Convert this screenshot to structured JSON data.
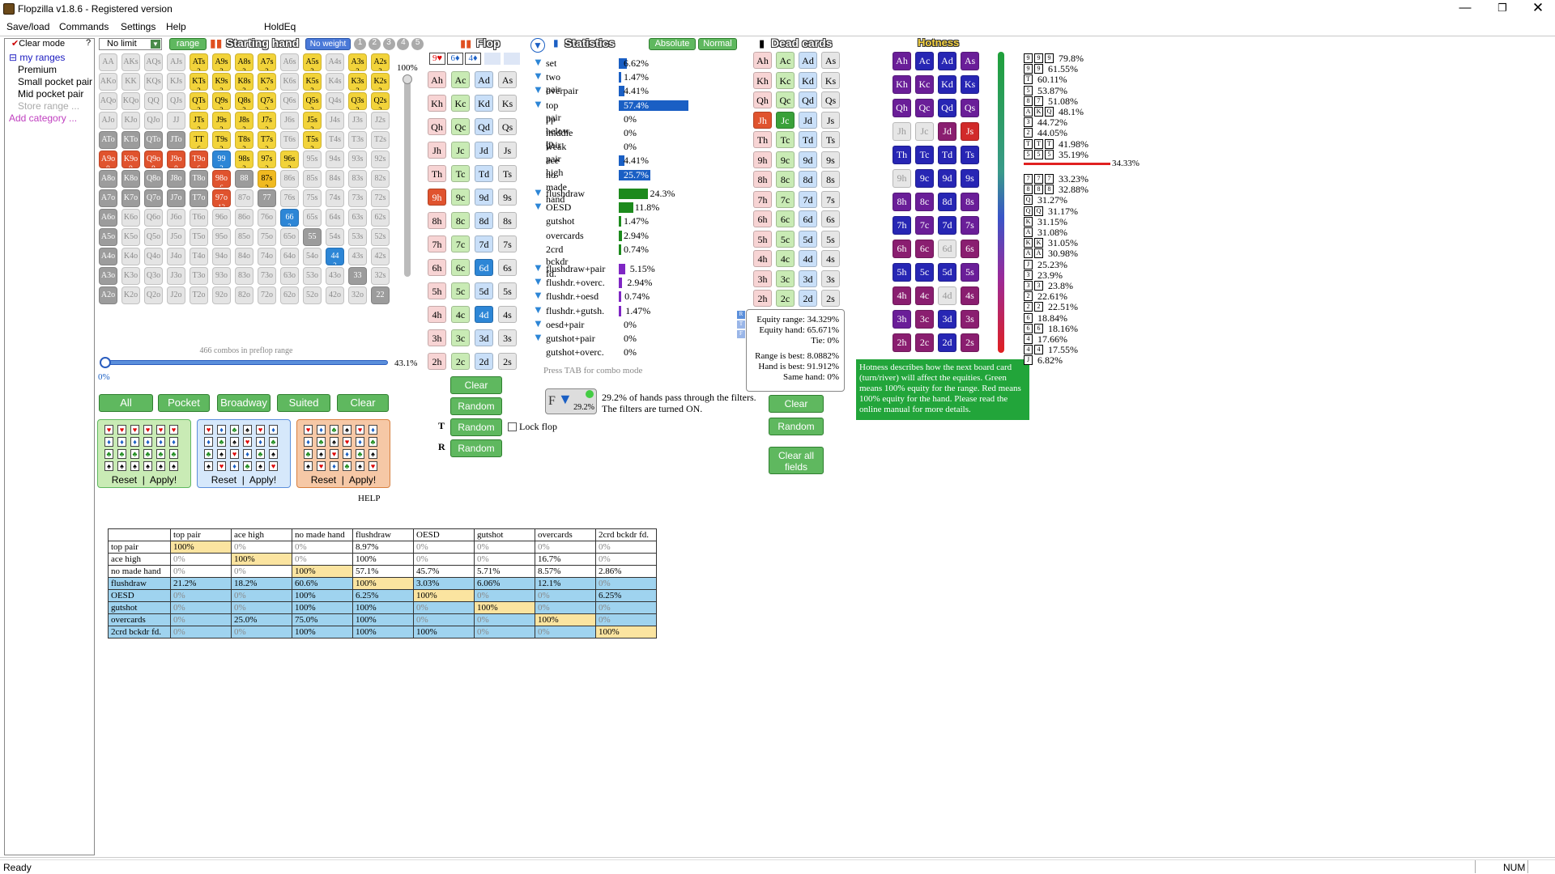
{
  "window": {
    "title": "Flopzilla v1.8.6 - Registered version"
  },
  "menu": [
    "Save/load",
    "Commands",
    "Settings",
    "Help",
    "HoldEq"
  ],
  "status": {
    "text": "Ready",
    "num": "NUM"
  },
  "left": {
    "clear_mode": "Clear mode",
    "help_q": "?",
    "root": "my ranges",
    "items": [
      "Premium",
      "Small pocket pair",
      "Mid pocket pair"
    ],
    "store": "Store range ...",
    "add": "Add category ..."
  },
  "range": {
    "limit": "No limit",
    "range_btn": "range",
    "header": "Starting hand",
    "noweight": "No weight",
    "weights": [
      "1",
      "2",
      "3",
      "4",
      "5"
    ],
    "pct_top": "100%",
    "combos": "466 combos in preflop range",
    "slider_pct": "43.1%",
    "slider_min": "0%",
    "buttons": [
      "All",
      "Pocket",
      "Broadway",
      "Suited",
      "Clear"
    ],
    "reset": "Reset",
    "apply": "Apply!",
    "help": "HELP"
  },
  "grid": [
    [
      "AA",
      "AKs",
      "AQs",
      "AJs",
      "ATs",
      "A9s",
      "A8s",
      "A7s",
      "A6s",
      "A5s",
      "A4s",
      "A3s",
      "A2s"
    ],
    [
      "AKo",
      "KK",
      "KQs",
      "KJs",
      "KTs",
      "K9s",
      "K8s",
      "K7s",
      "K6s",
      "K5s",
      "K4s",
      "K3s",
      "K2s"
    ],
    [
      "AQo",
      "KQo",
      "QQ",
      "QJs",
      "QTs",
      "Q9s",
      "Q8s",
      "Q7s",
      "Q6s",
      "Q5s",
      "Q4s",
      "Q3s",
      "Q2s"
    ],
    [
      "AJo",
      "KJo",
      "QJo",
      "JJ",
      "JTs",
      "J9s",
      "J8s",
      "J7s",
      "J6s",
      "J5s",
      "J4s",
      "J3s",
      "J2s"
    ],
    [
      "ATo",
      "KTo",
      "QTo",
      "JTo",
      "TT",
      "T9s",
      "T8s",
      "T7s",
      "T6s",
      "T5s",
      "T4s",
      "T3s",
      "T2s"
    ],
    [
      "A9o",
      "K9o",
      "Q9o",
      "J9o",
      "T9o",
      "99",
      "98s",
      "97s",
      "96s",
      "95s",
      "94s",
      "93s",
      "92s"
    ],
    [
      "A8o",
      "K8o",
      "Q8o",
      "J8o",
      "T8o",
      "98o",
      "88",
      "87s",
      "86s",
      "85s",
      "84s",
      "83s",
      "82s"
    ],
    [
      "A7o",
      "K7o",
      "Q7o",
      "J7o",
      "T7o",
      "97o",
      "87o",
      "77",
      "76s",
      "75s",
      "74s",
      "73s",
      "72s"
    ],
    [
      "A6o",
      "K6o",
      "Q6o",
      "J6o",
      "T6o",
      "96o",
      "86o",
      "76o",
      "66",
      "65s",
      "64s",
      "63s",
      "62s"
    ],
    [
      "A5o",
      "K5o",
      "Q5o",
      "J5o",
      "T5o",
      "95o",
      "85o",
      "75o",
      "65o",
      "55",
      "54s",
      "53s",
      "52s"
    ],
    [
      "A4o",
      "K4o",
      "Q4o",
      "J4o",
      "T4o",
      "94o",
      "84o",
      "74o",
      "64o",
      "54o",
      "44",
      "43s",
      "42s"
    ],
    [
      "A3o",
      "K3o",
      "Q3o",
      "J3o",
      "T3o",
      "93o",
      "83o",
      "73o",
      "63o",
      "53o",
      "43o",
      "33",
      "32s"
    ],
    [
      "A2o",
      "K2o",
      "Q2o",
      "J2o",
      "T2o",
      "92o",
      "82o",
      "72o",
      "62o",
      "52o",
      "42o",
      "32o",
      "22"
    ]
  ],
  "grid_counts": {
    "ATs": "3",
    "A9s": "3",
    "A8s": "3",
    "A7s": "3",
    "A5s": "3",
    "A3s": "3",
    "A2s": "3",
    "KTs": "3",
    "K9s": "3",
    "K8s": "3",
    "K7s": "3",
    "K5s": "3",
    "K3s": "3",
    "K2s": "3",
    "QTs": "3",
    "Q9s": "3",
    "Q8s": "3",
    "Q7s": "3",
    "Q5s": "3",
    "Q3s": "3",
    "Q2s": "3",
    "JTs": "3",
    "J9s": "3",
    "J8s": "3",
    "J7s": "3",
    "J5s": "3",
    "TT": "6",
    "T9s": "2",
    "T8s": "3",
    "T7s": "3",
    "T5s": "3",
    "A9o": "9",
    "K9o": "9",
    "Q9o": "9",
    "J9o": "9",
    "T9o": "6",
    "99": "3",
    "98s": "2",
    "97s": "2",
    "96s": "2",
    "98o": "6",
    "87s": "3",
    "97o": "12",
    "66": "3",
    "44": "3"
  },
  "flop": {
    "header": "Flop",
    "board": [
      "9♥",
      "6♦",
      "4♦"
    ],
    "random": "Random",
    "clear": "Clear",
    "lock": "Lock flop",
    "filter_pct": "29.2%",
    "filter_text1": "29.2% of hands pass through the filters.",
    "filter_text2": "The filters are turned ON.",
    "tab_note": "Press TAB for combo mode"
  },
  "stats": {
    "header": "Statistics",
    "absolute": "Absolute",
    "normal": "Normal",
    "rows": [
      {
        "label": "set",
        "pct": "6.62%",
        "v": 6.62,
        "f": true
      },
      {
        "label": "two pair",
        "pct": "1.47%",
        "v": 1.47,
        "f": true
      },
      {
        "label": "overpair",
        "pct": "4.41%",
        "v": 4.41,
        "f": true
      },
      {
        "label": "top pair",
        "pct": "57.4%",
        "v": 57.4,
        "f": true
      },
      {
        "label": "pp below tp",
        "pct": "0%",
        "v": 0,
        "f": false
      },
      {
        "label": "middle pair",
        "pct": "0%",
        "v": 0,
        "f": false
      },
      {
        "label": "weak pair",
        "pct": "0%",
        "v": 0,
        "f": false
      },
      {
        "label": "ace high",
        "pct": "4.41%",
        "v": 4.41,
        "f": false
      },
      {
        "label": "no made hand",
        "pct": "25.7%",
        "v": 25.7,
        "f": false
      }
    ],
    "draws": [
      {
        "label": "flushdraw",
        "pct": "24.3%",
        "v": 24.3,
        "f": true
      },
      {
        "label": "OESD",
        "pct": "11.8%",
        "v": 11.8,
        "f": true
      },
      {
        "label": "gutshot",
        "pct": "1.47%",
        "v": 1.47,
        "f": false
      },
      {
        "label": "overcards",
        "pct": "2.94%",
        "v": 2.94,
        "f": false
      },
      {
        "label": "2crd bckdr fd.",
        "pct": "0.74%",
        "v": 0.74,
        "f": false
      }
    ],
    "combos": [
      {
        "label": "flushdraw+pair",
        "pct": "5.15%",
        "v": 5.15
      },
      {
        "label": "flushdr.+overc.",
        "pct": "2.94%",
        "v": 2.94
      },
      {
        "label": "flushdr.+oesd",
        "pct": "0.74%",
        "v": 0.74
      },
      {
        "label": "flushdr.+gutsh.",
        "pct": "1.47%",
        "v": 1.47
      },
      {
        "label": "oesd+pair",
        "pct": "0%",
        "v": 0
      },
      {
        "label": "gutshot+pair",
        "pct": "0%",
        "v": 0
      },
      {
        "label": "gutshot+overc.",
        "pct": "0%",
        "v": 0
      }
    ]
  },
  "dead": {
    "header": "Dead cards",
    "clear": "Clear",
    "random": "Random",
    "clear_all": "Clear all fields"
  },
  "equity": {
    "range": "Equity range: 34.329%",
    "hand": "Equity hand: 65.671%",
    "tie": "Tie: 0%",
    "rbest": "Range is best: 8.0882%",
    "hbest": "Hand is best: 91.912%",
    "same": "Same hand: 0%"
  },
  "hotness": {
    "header": "Hotness",
    "info": "Hotness describes how the next board card (turn/river) will affect the equities. Green means 100% equity for the range. Red means 100% equity for the hand. Please read the online manual for more details.",
    "avg": "34.33%",
    "list": [
      {
        "cards": [
          "9",
          "9",
          "9"
        ],
        "pct": "79.8%"
      },
      {
        "cards": [
          "9",
          "9"
        ],
        "pct": "61.55%"
      },
      {
        "cards": [
          "T"
        ],
        "pct": "60.11%"
      },
      {
        "cards": [
          "5"
        ],
        "pct": "53.87%"
      },
      {
        "cards": [
          "8",
          "7"
        ],
        "pct": "51.08%"
      },
      {
        "cards": [
          "A",
          "K",
          "Q"
        ],
        "pct": "48.1%"
      },
      {
        "cards": [
          "3"
        ],
        "pct": "44.72%"
      },
      {
        "cards": [
          "2"
        ],
        "pct": "44.05%"
      },
      {
        "cards": [
          "T",
          "T",
          "T"
        ],
        "pct": "41.98%"
      },
      {
        "cards": [
          "5",
          "5",
          "5"
        ],
        "pct": "35.19%"
      },
      {
        "cards": [
          "7",
          "7",
          "7"
        ],
        "pct": "33.23%"
      },
      {
        "cards": [
          "8",
          "8",
          "8"
        ],
        "pct": "32.88%"
      },
      {
        "cards": [
          "Q"
        ],
        "pct": "31.27%"
      },
      {
        "cards": [
          "Q",
          "Q"
        ],
        "pct": "31.17%"
      },
      {
        "cards": [
          "K"
        ],
        "pct": "31.15%"
      },
      {
        "cards": [
          "A"
        ],
        "pct": "31.08%"
      },
      {
        "cards": [
          "K",
          "K"
        ],
        "pct": "31.05%"
      },
      {
        "cards": [
          "A",
          "A"
        ],
        "pct": "30.98%"
      },
      {
        "cards": [
          "J"
        ],
        "pct": "25.23%"
      },
      {
        "cards": [
          "3"
        ],
        "pct": "23.9%"
      },
      {
        "cards": [
          "3",
          "3"
        ],
        "pct": "23.8%"
      },
      {
        "cards": [
          "2"
        ],
        "pct": "22.61%"
      },
      {
        "cards": [
          "2",
          "2"
        ],
        "pct": "22.51%"
      },
      {
        "cards": [
          "6"
        ],
        "pct": "18.84%"
      },
      {
        "cards": [
          "6",
          "6"
        ],
        "pct": "18.16%"
      },
      {
        "cards": [
          "4"
        ],
        "pct": "17.66%"
      },
      {
        "cards": [
          "4",
          "4"
        ],
        "pct": "17.55%"
      },
      {
        "cards": [
          "J"
        ],
        "pct": "6.82%"
      }
    ]
  },
  "table": {
    "headers": [
      "",
      "top pair",
      "ace high",
      "no made hand",
      "flushdraw",
      "OESD",
      "gutshot",
      "overcards",
      "2crd bckdr fd."
    ],
    "rows": [
      [
        "top pair",
        "100%",
        "0%",
        "0%",
        "8.97%",
        "0%",
        "0%",
        "0%",
        "0%"
      ],
      [
        "ace high",
        "0%",
        "100%",
        "0%",
        "100%",
        "0%",
        "0%",
        "16.7%",
        "0%"
      ],
      [
        "no made hand",
        "0%",
        "0%",
        "100%",
        "57.1%",
        "45.7%",
        "5.71%",
        "8.57%",
        "2.86%"
      ],
      [
        "flushdraw",
        "21.2%",
        "18.2%",
        "60.6%",
        "100%",
        "3.03%",
        "6.06%",
        "12.1%",
        "0%"
      ],
      [
        "OESD",
        "0%",
        "0%",
        "100%",
        "6.25%",
        "100%",
        "0%",
        "0%",
        "6.25%"
      ],
      [
        "gutshot",
        "0%",
        "0%",
        "100%",
        "100%",
        "0%",
        "100%",
        "0%",
        "0%"
      ],
      [
        "overcards",
        "0%",
        "25.0%",
        "75.0%",
        "100%",
        "0%",
        "0%",
        "100%",
        "0%"
      ],
      [
        "2crd bckdr fd.",
        "0%",
        "0%",
        "100%",
        "100%",
        "100%",
        "0%",
        "0%",
        "100%"
      ]
    ]
  }
}
